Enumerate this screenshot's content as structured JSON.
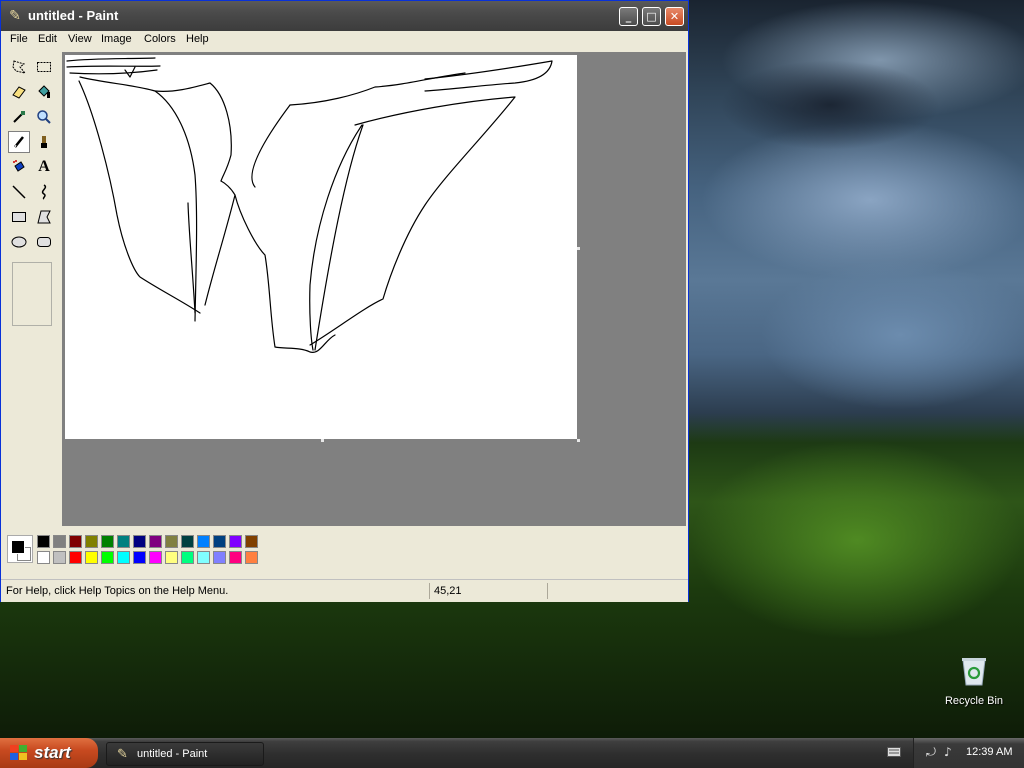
{
  "window": {
    "title": "untitled - Paint",
    "minimize_glyph": "_",
    "maximize_glyph": "□",
    "close_glyph": "✕"
  },
  "menu": [
    "File",
    "Edit",
    "View",
    "Image",
    "Colors",
    "Help"
  ],
  "tools": [
    "free-form-select",
    "select",
    "eraser",
    "fill-with-color",
    "pick-color",
    "magnifier",
    "pencil",
    "brush",
    "airbrush",
    "text",
    "line",
    "curve",
    "rectangle",
    "polygon",
    "ellipse",
    "rounded-rectangle"
  ],
  "selected_tool": "pencil",
  "text_tool_glyph": "A",
  "palette": {
    "foreground": "#000000",
    "background": "#ffffff",
    "row1": [
      "#000000",
      "#808080",
      "#800000",
      "#808000",
      "#008000",
      "#008080",
      "#000080",
      "#800080",
      "#808040",
      "#004040",
      "#0080ff",
      "#004080",
      "#8000ff",
      "#804000"
    ],
    "row2": [
      "#ffffff",
      "#c0c0c0",
      "#ff0000",
      "#ffff00",
      "#00ff00",
      "#00ffff",
      "#0000ff",
      "#ff00ff",
      "#ffff80",
      "#00ff80",
      "#80ffff",
      "#8080ff",
      "#ff0080",
      "#ff8040"
    ]
  },
  "status": {
    "help_text": "For Help, click Help Topics on the Help Menu.",
    "coords": "45,21"
  },
  "desktop": {
    "recycle_bin_label": "Recycle Bin"
  },
  "taskbar": {
    "start_label": "start",
    "task_label": "untitled - Paint",
    "clock": "12:39 AM"
  }
}
